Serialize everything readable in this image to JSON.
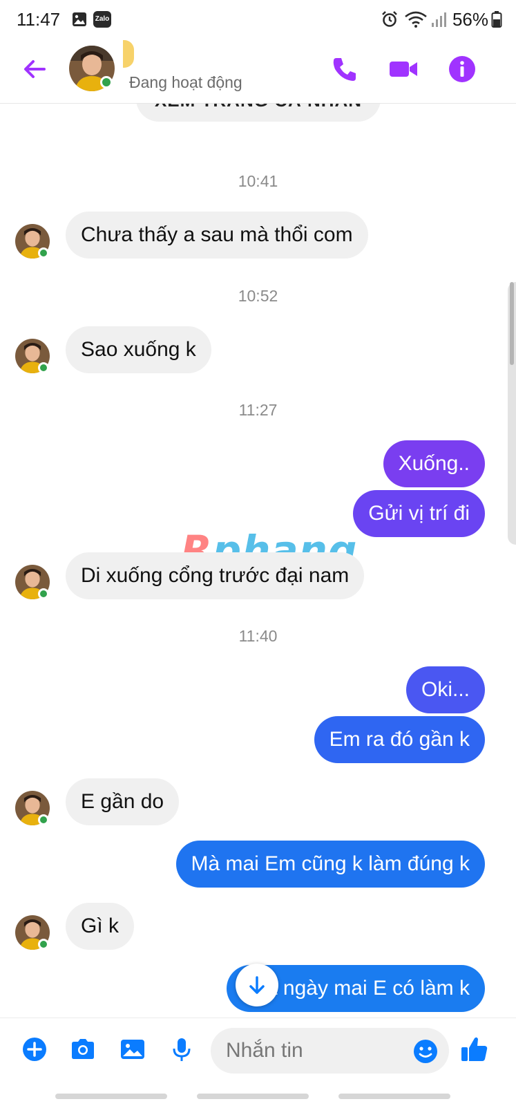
{
  "status_bar": {
    "time": "11:47",
    "zalo_label": "Zalo",
    "battery_percent": "56%"
  },
  "header": {
    "status": "Đang hoạt động",
    "accent_color": "#a033ff"
  },
  "chat": {
    "profile_button": "XEM TRANG CÁ NHÂN",
    "watermark": {
      "part1": "R",
      "part2": "phang"
    },
    "items": [
      {
        "type": "time",
        "text": "10:41"
      },
      {
        "type": "in",
        "text": "Chưa thấy a sau mà thổi com"
      },
      {
        "type": "time",
        "text": "10:52"
      },
      {
        "type": "in",
        "text": "Sao xuống k"
      },
      {
        "type": "time",
        "text": "11:27"
      },
      {
        "type": "out",
        "text": "Xuống..",
        "color": "#7a3ef0"
      },
      {
        "type": "out",
        "text": "Gửi vị trí đi",
        "color": "#6a44f2"
      },
      {
        "type": "in",
        "text": "Di xuống cổng trước đại nam"
      },
      {
        "type": "time",
        "text": "11:40"
      },
      {
        "type": "out",
        "text": "Oki...",
        "color": "#4a57f2"
      },
      {
        "type": "out",
        "text": "Em ra đó gần k",
        "color": "#2f66f2"
      },
      {
        "type": "in",
        "text": "E gần do"
      },
      {
        "type": "out",
        "text": "Mà mai Em cũng k làm đúng k",
        "color": "#1f74f0"
      },
      {
        "type": "in",
        "text": "Gì k"
      },
      {
        "type": "out",
        "text": "Ý là ngày mai E có làm k",
        "color": "#1a7cf0"
      }
    ]
  },
  "composer": {
    "placeholder": "Nhắn tin",
    "icon_color": "#0a7cff"
  }
}
